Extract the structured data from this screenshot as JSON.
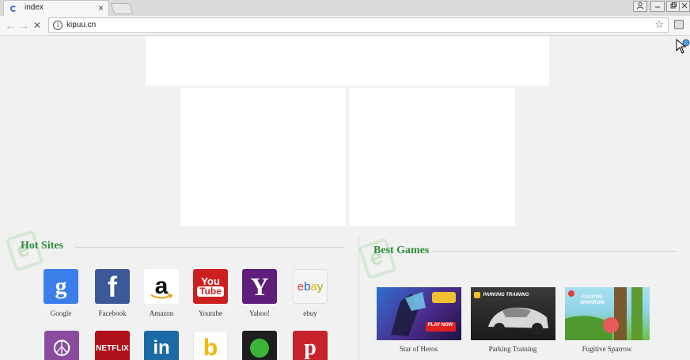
{
  "browser": {
    "tab_title": "index",
    "tab_close": "×",
    "url": "kipuu.cn",
    "info_glyph": "i",
    "star_glyph": "☆",
    "back_glyph": "←",
    "forward_glyph": "→",
    "reload_glyph": "✕"
  },
  "hot_sites": {
    "title": "Hot Sites",
    "items": [
      {
        "label": "Google",
        "icon": "google-icon",
        "glyph": "g",
        "color": "#3b7de9"
      },
      {
        "label": "Facebook",
        "icon": "facebook-icon",
        "glyph": "f",
        "color": "#3b5998"
      },
      {
        "label": "Amazon",
        "icon": "amazon-icon",
        "glyph": "a",
        "color": "#ffffff"
      },
      {
        "label": "Youtube",
        "icon": "youtube-icon",
        "glyph": "You Tube",
        "color": "#cc2020"
      },
      {
        "label": "Yahoo!",
        "icon": "yahoo-icon",
        "glyph": "Y",
        "color": "#5f1e7a"
      },
      {
        "label": "ebuy",
        "icon": "ebay-icon",
        "glyph": "ebay",
        "color": "#f4f4f4"
      }
    ],
    "row2": [
      {
        "icon": "peace-icon",
        "glyph": "☮",
        "color": "#8a4c9e"
      },
      {
        "icon": "netflix-icon",
        "glyph": "NETFLIX",
        "color": "#b0101a"
      },
      {
        "icon": "linkedin-icon",
        "glyph": "in",
        "color": "#1b6aa5"
      },
      {
        "icon": "bing-icon",
        "glyph": "b",
        "color": "#ffffff"
      },
      {
        "icon": "green-dot-icon",
        "glyph": "",
        "color": "#1e1e1e"
      },
      {
        "icon": "pinterest-icon",
        "glyph": "p",
        "color": "#c8232c"
      }
    ]
  },
  "best_games": {
    "title": "Best Games",
    "items": [
      {
        "label": "Star of Heros",
        "thumb_text": "PLAY NOW",
        "colors": [
          "#4b2c8c",
          "#2f6fd1"
        ]
      },
      {
        "label": "Parking Training",
        "thumb_text": "PARKING TRAINING",
        "colors": [
          "#2a2a2a",
          "#6a6a6a"
        ]
      },
      {
        "label": "Fugitive Sparrow",
        "thumb_text": "FUGITIVE SPARROW",
        "colors": [
          "#8fd3e8",
          "#6cc04a"
        ]
      }
    ]
  }
}
